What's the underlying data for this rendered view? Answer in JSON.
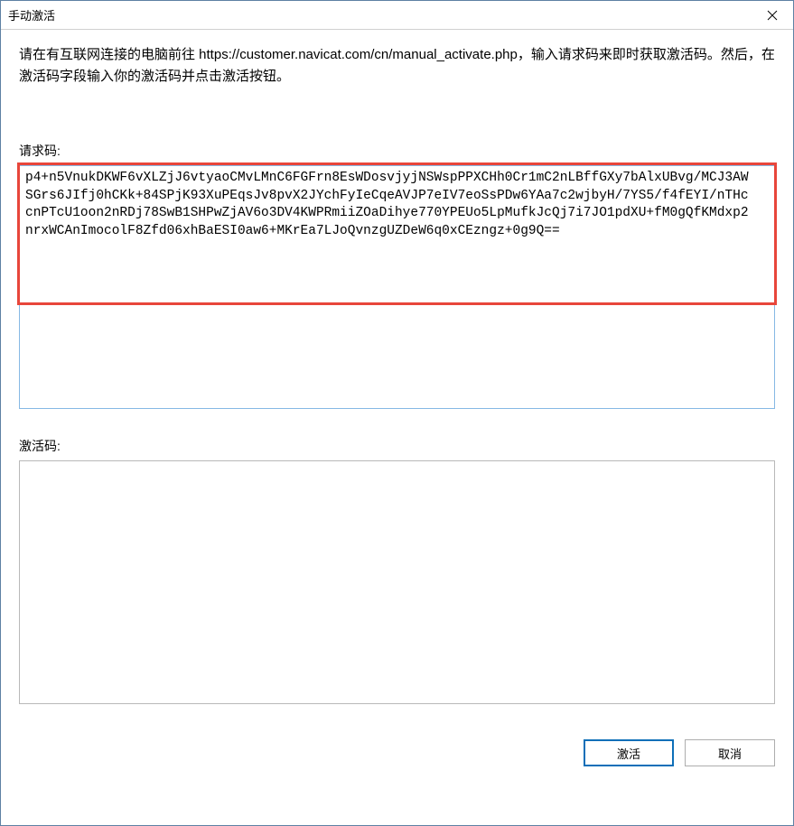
{
  "window": {
    "title": "手动激活"
  },
  "instructions": "请在有互联网连接的电脑前往 https://customer.navicat.com/cn/manual_activate.php，输入请求码来即时获取激活码。然后，在激活码字段输入你的激活码并点击激活按钮。",
  "request": {
    "label": "请求码:",
    "value": "p4+n5VnukDKWF6vXLZjJ6vtyaoCMvLMnC6FGFrn8EsWDosvjyjNSWspPPXCHh0Cr1mC2nLBffGXy7bAlxUBvg/MCJ3AWSGrs6JIfj0hCKk+84SPjK93XuPEqsJv8pvX2JYchFyIeCqeAVJP7eIV7eoSsPDw6YAa7c2wjbyH/7YS5/f4fEYI/nTHccnPTcU1oon2nRDj78SwB1SHPwZjAV6o3DV4KWPRmiiZOaDihye770YPEUo5LpMufkJcQj7i7JO1pdXU+fM0gQfKMdxp2nrxWCAnImocolF8Zfd06xhBaESI0aw6+MKrEa7LJoQvnzgUZDeW6q0xCEzngz+0g9Q=="
  },
  "activation": {
    "label": "激活码:",
    "value": ""
  },
  "buttons": {
    "activate": "激活",
    "cancel": "取消"
  }
}
